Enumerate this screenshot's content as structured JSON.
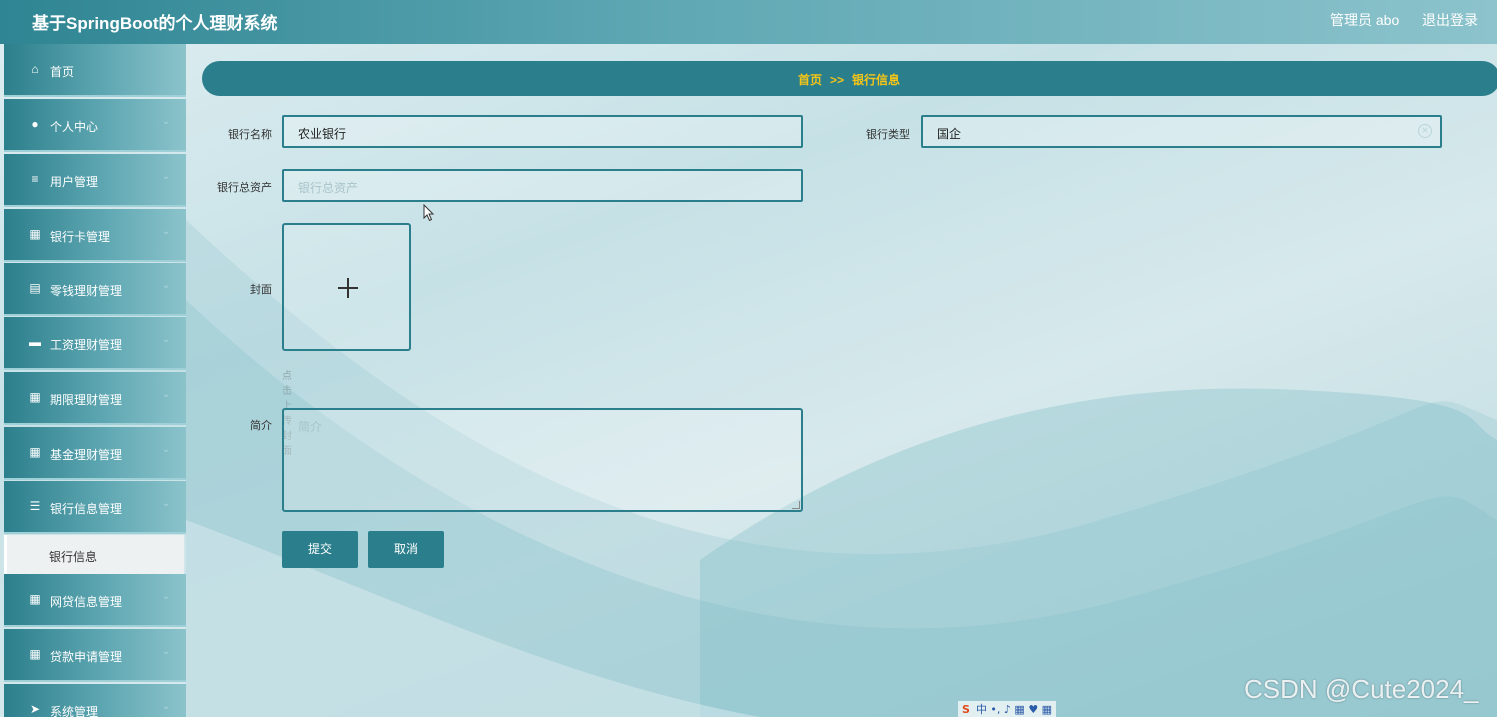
{
  "header": {
    "title": "基于SpringBoot的个人理财系统",
    "admin_label": "管理员 abo",
    "logout_label": "退出登录"
  },
  "sidebar": {
    "items": [
      {
        "label": "首页",
        "icon": "home-icon",
        "glyph": "⌂"
      },
      {
        "label": "个人中心",
        "icon": "user-icon",
        "glyph": "●",
        "arrow": "⌄"
      },
      {
        "label": "用户管理",
        "icon": "sliders-icon",
        "glyph": "≡",
        "arrow": "⌄"
      },
      {
        "label": "银行卡管理",
        "icon": "grid-icon",
        "glyph": "▦",
        "arrow": "⌄"
      },
      {
        "label": "零钱理财管理",
        "icon": "document-icon",
        "glyph": "▤",
        "arrow": "⌄"
      },
      {
        "label": "工资理财管理",
        "icon": "ticket-icon",
        "glyph": "▬",
        "arrow": "⌄"
      },
      {
        "label": "期限理财管理",
        "icon": "grid-icon",
        "glyph": "▦",
        "arrow": "⌄"
      },
      {
        "label": "基金理财管理",
        "icon": "grid-icon",
        "glyph": "▦",
        "arrow": "⌄"
      },
      {
        "label": "银行信息管理",
        "icon": "list-icon",
        "glyph": "☰",
        "arrow": "⌄"
      },
      {
        "label": "网贷信息管理",
        "icon": "grid-icon",
        "glyph": "▦",
        "arrow": "⌄"
      },
      {
        "label": "贷款申请管理",
        "icon": "grid-icon",
        "glyph": "▦",
        "arrow": "⌄"
      },
      {
        "label": "系统管理",
        "icon": "send-icon",
        "glyph": "➤",
        "arrow": "⌄"
      }
    ],
    "active_submenu": "银行信息"
  },
  "breadcrumb": {
    "home": "首页",
    "separator": ">>",
    "current": "银行信息"
  },
  "form": {
    "bank_name_label": "银行名称",
    "bank_name_value": "农业银行",
    "bank_type_label": "银行类型",
    "bank_type_value": "国企",
    "total_assets_label": "银行总资产",
    "total_assets_placeholder": "银行总资产",
    "cover_label": "封面",
    "cover_hint": "点击上传封面",
    "intro_label": "简介",
    "intro_placeholder": "简介",
    "submit_label": "提交",
    "cancel_label": "取消"
  },
  "ime_toolbar": {
    "logo": "S",
    "items": "中 •, ♪ ▦ ♥ ▦"
  },
  "watermark": "CSDN @Cute2024_",
  "colors": {
    "primary": "#2b7f8c",
    "breadcrumb_text": "#f5c518",
    "sidebar_gradient_start": "#2c7f8c"
  }
}
